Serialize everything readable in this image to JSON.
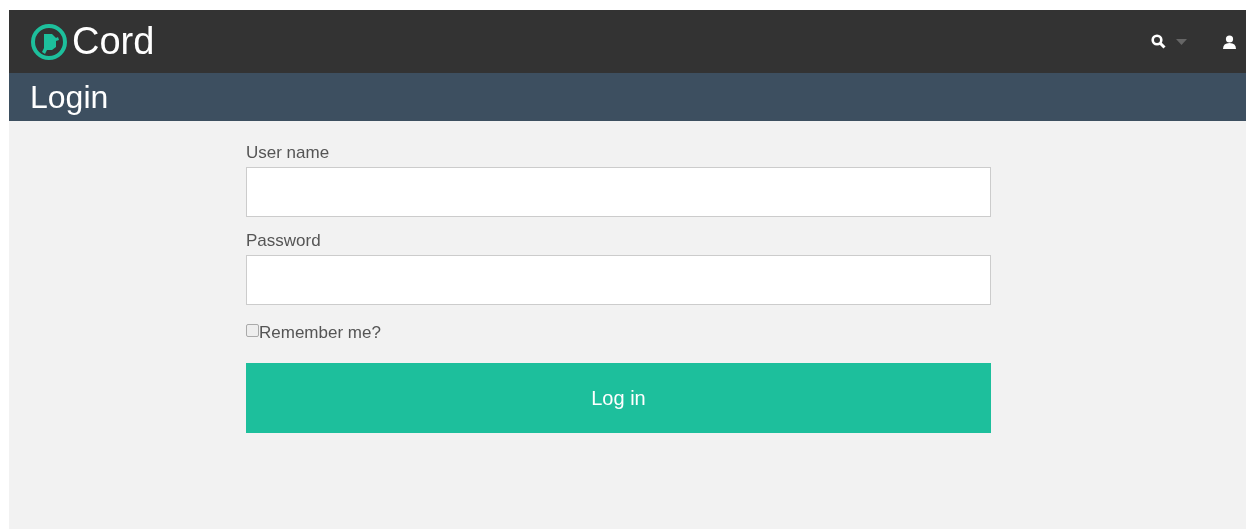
{
  "navbar": {
    "brand": "Cord"
  },
  "header": {
    "title": "Login"
  },
  "form": {
    "fields": [
      {
        "label": "User name"
      },
      {
        "label": "Password"
      }
    ],
    "remember": {
      "label": "Remember me?",
      "checked": false
    },
    "submit": "Log in"
  }
}
